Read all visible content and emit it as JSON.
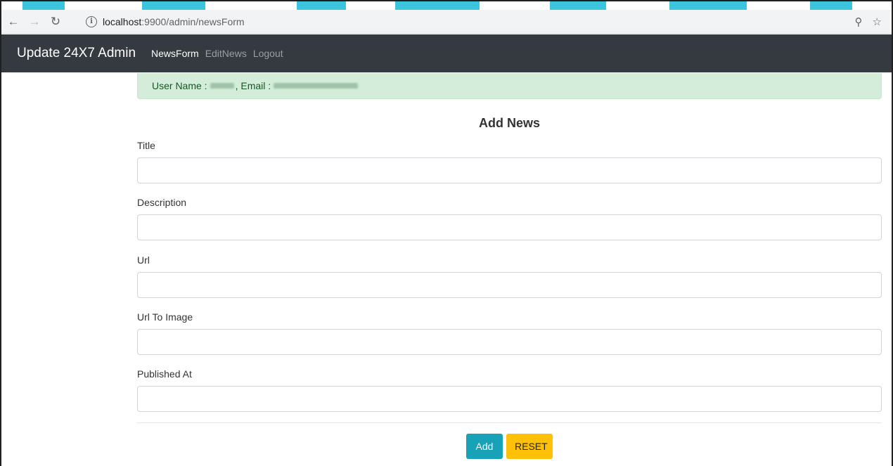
{
  "browser": {
    "url_host": "localhost",
    "url_path": ":9900/admin/newsForm"
  },
  "navbar": {
    "brand": "Update 24X7 Admin",
    "links": [
      {
        "label": "NewsForm",
        "active": true
      },
      {
        "label": "EditNews",
        "active": false
      },
      {
        "label": "Logout",
        "active": false
      }
    ]
  },
  "alert": {
    "user_label": "User Name :",
    "email_label": ", Email :"
  },
  "form": {
    "title": "Add News",
    "fields": [
      {
        "label": "Title",
        "value": ""
      },
      {
        "label": "Description",
        "value": ""
      },
      {
        "label": "Url",
        "value": ""
      },
      {
        "label": "Url To Image",
        "value": ""
      },
      {
        "label": "Published At",
        "value": ""
      }
    ],
    "add_label": "Add",
    "reset_label": "RESET"
  },
  "colors": {
    "navbar_bg": "#343a40",
    "alert_bg": "#d4edda",
    "add_button": "#17a2b8",
    "reset_button": "#ffc107"
  }
}
